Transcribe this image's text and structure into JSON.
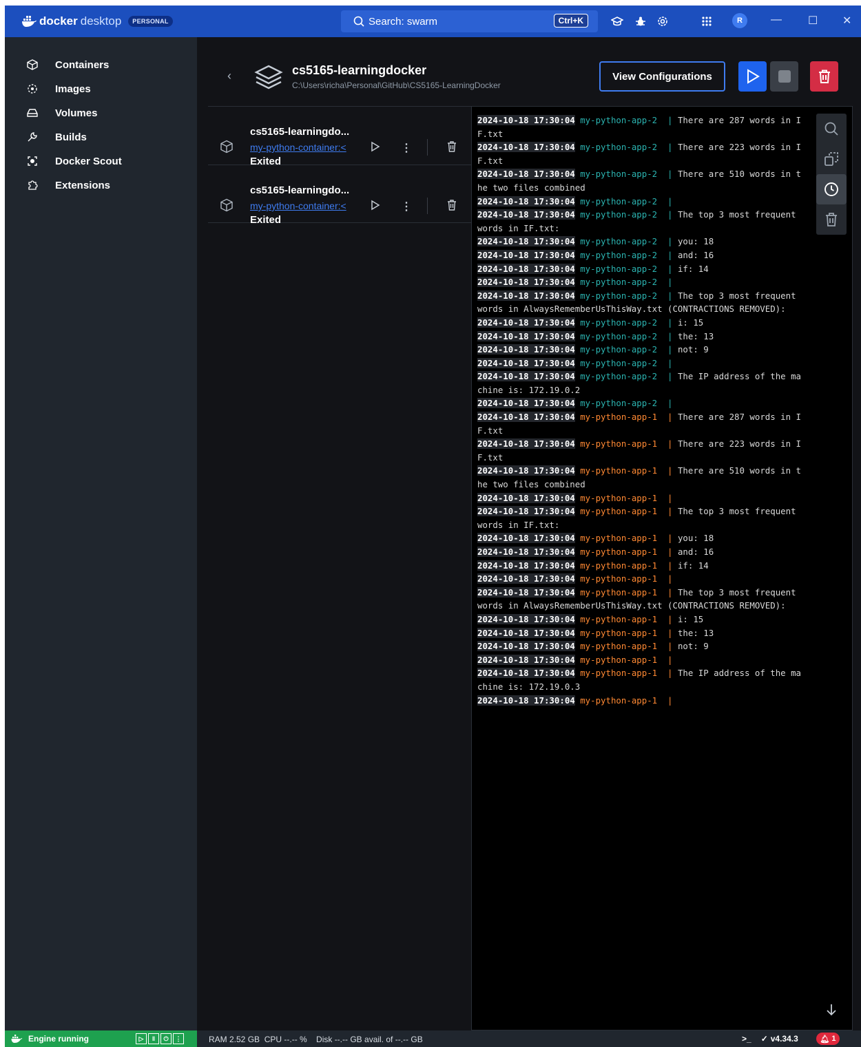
{
  "titlebar": {
    "brand_bold": "docker",
    "brand_light": "desktop",
    "plan_badge": "PERSONAL",
    "search_text": "Search: swarm",
    "shortcut": "Ctrl+K",
    "avatar_initial": "R",
    "icons": [
      "learning-center-icon",
      "bug-icon",
      "settings-gear-icon",
      "grid-apps-icon"
    ]
  },
  "sidebar": {
    "items": [
      {
        "label": "Containers",
        "icon": "cube-icon"
      },
      {
        "label": "Images",
        "icon": "image-layers-icon"
      },
      {
        "label": "Volumes",
        "icon": "drive-icon"
      },
      {
        "label": "Builds",
        "icon": "wrench-icon"
      },
      {
        "label": "Docker Scout",
        "icon": "scout-icon"
      },
      {
        "label": "Extensions",
        "icon": "puzzle-icon"
      }
    ]
  },
  "header": {
    "title": "cs5165-learningdocker",
    "path": "C:\\Users\\richa\\Personal\\GitHub\\CS5165-LearningDocker",
    "view_config_label": "View Configurations"
  },
  "containers": [
    {
      "name": "cs5165-learningdo...",
      "image": "my-python-container:<",
      "status": "Exited"
    },
    {
      "name": "cs5165-learningdo...",
      "image": "my-python-container:<",
      "status": "Exited"
    }
  ],
  "logs": [
    {
      "ts": "2024-10-18 17:30:04",
      "src": "my-python-app-2",
      "c": "c2",
      "msg": "There are 287 words in I"
    },
    {
      "cont": "F.txt"
    },
    {
      "ts": "2024-10-18 17:30:04",
      "src": "my-python-app-2",
      "c": "c2",
      "msg": "There are 223 words in I"
    },
    {
      "cont": "F.txt"
    },
    {
      "ts": "2024-10-18 17:30:04",
      "src": "my-python-app-2",
      "c": "c2",
      "msg": "There are 510 words in t"
    },
    {
      "cont": "he two files combined"
    },
    {
      "ts": "2024-10-18 17:30:04",
      "src": "my-python-app-2",
      "c": "c2",
      "msg": ""
    },
    {
      "ts": "2024-10-18 17:30:04",
      "src": "my-python-app-2",
      "c": "c2",
      "msg": "The top 3 most frequent"
    },
    {
      "cont": "words in IF.txt:"
    },
    {
      "ts": "2024-10-18 17:30:04",
      "src": "my-python-app-2",
      "c": "c2",
      "msg": "you: 18"
    },
    {
      "ts": "2024-10-18 17:30:04",
      "src": "my-python-app-2",
      "c": "c2",
      "msg": "and: 16"
    },
    {
      "ts": "2024-10-18 17:30:04",
      "src": "my-python-app-2",
      "c": "c2",
      "msg": "if: 14"
    },
    {
      "ts": "2024-10-18 17:30:04",
      "src": "my-python-app-2",
      "c": "c2",
      "msg": ""
    },
    {
      "ts": "2024-10-18 17:30:04",
      "src": "my-python-app-2",
      "c": "c2",
      "msg": "The top 3 most frequent"
    },
    {
      "cont": "words in AlwaysRememberUsThisWay.txt (CONTRACTIONS REMOVED):"
    },
    {
      "ts": "2024-10-18 17:30:04",
      "src": "my-python-app-2",
      "c": "c2",
      "msg": "i: 15"
    },
    {
      "ts": "2024-10-18 17:30:04",
      "src": "my-python-app-2",
      "c": "c2",
      "msg": "the: 13"
    },
    {
      "ts": "2024-10-18 17:30:04",
      "src": "my-python-app-2",
      "c": "c2",
      "msg": "not: 9"
    },
    {
      "ts": "2024-10-18 17:30:04",
      "src": "my-python-app-2",
      "c": "c2",
      "msg": ""
    },
    {
      "ts": "2024-10-18 17:30:04",
      "src": "my-python-app-2",
      "c": "c2",
      "msg": "The IP address of the ma"
    },
    {
      "cont": "chine is: 172.19.0.2"
    },
    {
      "ts": "2024-10-18 17:30:04",
      "src": "my-python-app-2",
      "c": "c2",
      "msg": ""
    },
    {
      "ts": "2024-10-18 17:30:04",
      "src": "my-python-app-1",
      "c": "c1",
      "msg": "There are 287 words in I"
    },
    {
      "cont": "F.txt"
    },
    {
      "ts": "2024-10-18 17:30:04",
      "src": "my-python-app-1",
      "c": "c1",
      "msg": "There are 223 words in I"
    },
    {
      "cont": "F.txt"
    },
    {
      "ts": "2024-10-18 17:30:04",
      "src": "my-python-app-1",
      "c": "c1",
      "msg": "There are 510 words in t"
    },
    {
      "cont": "he two files combined"
    },
    {
      "ts": "2024-10-18 17:30:04",
      "src": "my-python-app-1",
      "c": "c1",
      "msg": ""
    },
    {
      "ts": "2024-10-18 17:30:04",
      "src": "my-python-app-1",
      "c": "c1",
      "msg": "The top 3 most frequent"
    },
    {
      "cont": "words in IF.txt:"
    },
    {
      "ts": "2024-10-18 17:30:04",
      "src": "my-python-app-1",
      "c": "c1",
      "msg": "you: 18"
    },
    {
      "ts": "2024-10-18 17:30:04",
      "src": "my-python-app-1",
      "c": "c1",
      "msg": "and: 16"
    },
    {
      "ts": "2024-10-18 17:30:04",
      "src": "my-python-app-1",
      "c": "c1",
      "msg": "if: 14"
    },
    {
      "ts": "2024-10-18 17:30:04",
      "src": "my-python-app-1",
      "c": "c1",
      "msg": ""
    },
    {
      "ts": "2024-10-18 17:30:04",
      "src": "my-python-app-1",
      "c": "c1",
      "msg": "The top 3 most frequent"
    },
    {
      "cont": "words in AlwaysRememberUsThisWay.txt (CONTRACTIONS REMOVED):"
    },
    {
      "ts": "2024-10-18 17:30:04",
      "src": "my-python-app-1",
      "c": "c1",
      "msg": "i: 15"
    },
    {
      "ts": "2024-10-18 17:30:04",
      "src": "my-python-app-1",
      "c": "c1",
      "msg": "the: 13"
    },
    {
      "ts": "2024-10-18 17:30:04",
      "src": "my-python-app-1",
      "c": "c1",
      "msg": "not: 9"
    },
    {
      "ts": "2024-10-18 17:30:04",
      "src": "my-python-app-1",
      "c": "c1",
      "msg": ""
    },
    {
      "ts": "2024-10-18 17:30:04",
      "src": "my-python-app-1",
      "c": "c1",
      "msg": "The IP address of the ma"
    },
    {
      "cont": "chine is: 172.19.0.3"
    },
    {
      "ts": "2024-10-18 17:30:04",
      "src": "my-python-app-1",
      "c": "c1",
      "msg": ""
    }
  ],
  "log_colors": {
    "c2": "#2bb3b0",
    "c1": "#ff8933"
  },
  "statusbar": {
    "engine": "Engine running",
    "stats": "RAM 2.52 GB  CPU --.-- %    Disk --.-- GB avail. of --.-- GB",
    "version": "v4.34.3",
    "notifications": "1"
  }
}
